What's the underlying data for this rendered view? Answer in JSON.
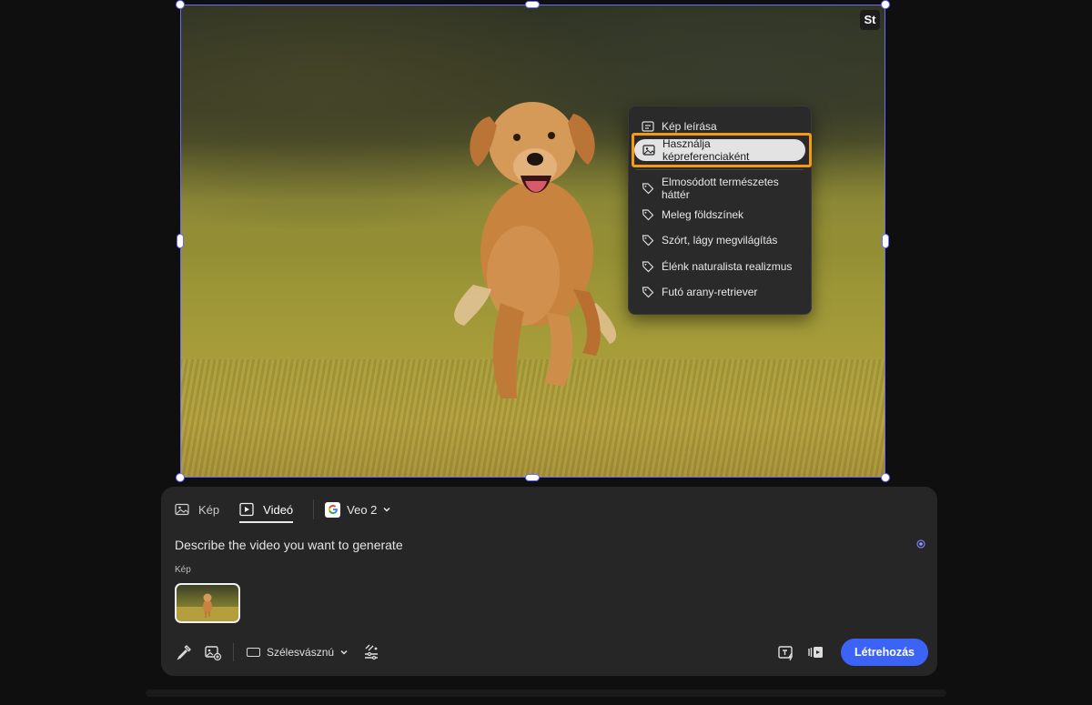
{
  "canvas": {
    "badge": "St"
  },
  "context_menu": {
    "describe_item": "Kép leírása",
    "use_as_reference_item": "Használja képreferenciaként",
    "tags": [
      "Elmosódott természetes háttér",
      "Meleg földszínek",
      "Szórt, lágy megvilágítás",
      "Élénk naturalista realizmus",
      "Futó arany-retriever"
    ]
  },
  "panel": {
    "tabs": [
      {
        "label": "Kép",
        "active": false
      },
      {
        "label": "Videó",
        "active": true
      }
    ],
    "model": "Veo 2",
    "prompt_placeholder": "Describe the video you want to generate",
    "image_label": "Kép",
    "aspect_ratio": "Szélesvásznú",
    "create_label": "Létrehozás"
  },
  "colors": {
    "accent": "#3b63f5",
    "selection": "#6b6bff",
    "highlight_outline": "#f59a12",
    "panel_bg": "#262626"
  }
}
